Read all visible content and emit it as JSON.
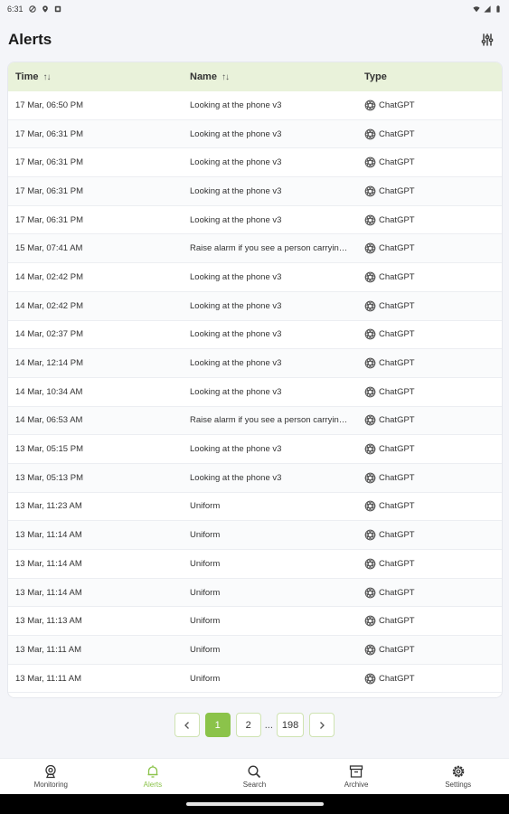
{
  "status_bar": {
    "time": "6:31"
  },
  "header": {
    "title": "Alerts"
  },
  "table": {
    "columns": {
      "time": "Time",
      "name": "Name",
      "type": "Type"
    },
    "rows": [
      {
        "time": "17 Mar, 06:50 PM",
        "name": "Looking at the phone v3",
        "type": "ChatGPT"
      },
      {
        "time": "17 Mar, 06:31 PM",
        "name": "Looking at the phone v3",
        "type": "ChatGPT"
      },
      {
        "time": "17 Mar, 06:31 PM",
        "name": "Looking at the phone v3",
        "type": "ChatGPT"
      },
      {
        "time": "17 Mar, 06:31 PM",
        "name": "Looking at the phone v3",
        "type": "ChatGPT"
      },
      {
        "time": "17 Mar, 06:31 PM",
        "name": "Looking at the phone v3",
        "type": "ChatGPT"
      },
      {
        "time": "15 Mar, 07:41 AM",
        "name": "Raise alarm if you see a person carrying a bag",
        "type": "ChatGPT"
      },
      {
        "time": "14 Mar, 02:42 PM",
        "name": "Looking at the phone v3",
        "type": "ChatGPT"
      },
      {
        "time": "14 Mar, 02:42 PM",
        "name": "Looking at the phone v3",
        "type": "ChatGPT"
      },
      {
        "time": "14 Mar, 02:37 PM",
        "name": "Looking at the phone v3",
        "type": "ChatGPT"
      },
      {
        "time": "14 Mar, 12:14 PM",
        "name": "Looking at the phone v3",
        "type": "ChatGPT"
      },
      {
        "time": "14 Mar, 10:34 AM",
        "name": "Looking at the phone v3",
        "type": "ChatGPT"
      },
      {
        "time": "14 Mar, 06:53 AM",
        "name": "Raise alarm if you see a person carrying a bag",
        "type": "ChatGPT"
      },
      {
        "time": "13 Mar, 05:15 PM",
        "name": "Looking at the phone v3",
        "type": "ChatGPT"
      },
      {
        "time": "13 Mar, 05:13 PM",
        "name": "Looking at the phone v3",
        "type": "ChatGPT"
      },
      {
        "time": "13 Mar, 11:23 AM",
        "name": "Uniform",
        "type": "ChatGPT"
      },
      {
        "time": "13 Mar, 11:14 AM",
        "name": "Uniform",
        "type": "ChatGPT"
      },
      {
        "time": "13 Mar, 11:14 AM",
        "name": "Uniform",
        "type": "ChatGPT"
      },
      {
        "time": "13 Mar, 11:14 AM",
        "name": "Uniform",
        "type": "ChatGPT"
      },
      {
        "time": "13 Mar, 11:13 AM",
        "name": "Uniform",
        "type": "ChatGPT"
      },
      {
        "time": "13 Mar, 11:11 AM",
        "name": "Uniform",
        "type": "ChatGPT"
      },
      {
        "time": "13 Mar, 11:11 AM",
        "name": "Uniform",
        "type": "ChatGPT"
      }
    ]
  },
  "pagination": {
    "prev_icon": "chevron-left-icon",
    "pages": [
      "1",
      "2"
    ],
    "ellipsis": "...",
    "last": "198",
    "current": "1",
    "next_icon": "chevron-right-icon"
  },
  "bottom_nav": [
    {
      "label": "Monitoring",
      "icon": "monitoring-icon",
      "active": false
    },
    {
      "label": "Alerts",
      "icon": "bell-icon",
      "active": true
    },
    {
      "label": "Search",
      "icon": "search-icon",
      "active": false
    },
    {
      "label": "Archive",
      "icon": "archive-icon",
      "active": false
    },
    {
      "label": "Settings",
      "icon": "gear-icon",
      "active": false
    }
  ],
  "colors": {
    "accent": "#8bc34a",
    "header_row": "#e9f2da",
    "background": "#f4f5f9"
  }
}
